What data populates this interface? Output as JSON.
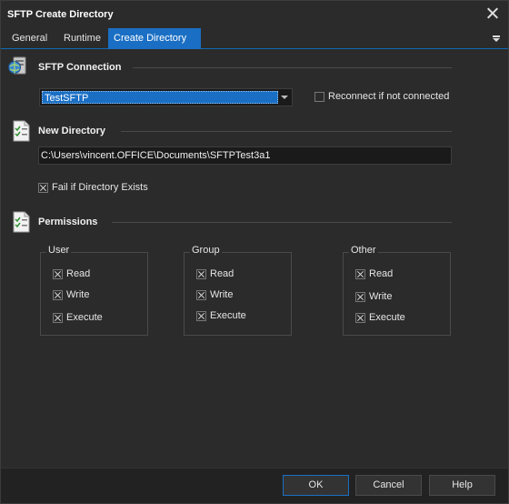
{
  "window": {
    "title": "SFTP Create Directory"
  },
  "tabs": [
    {
      "label": "General"
    },
    {
      "label": "Runtime"
    },
    {
      "label": "Create Directory"
    }
  ],
  "active_tab": "Create Directory",
  "sftp_connection": {
    "heading": "SFTP Connection",
    "selected": "TestSFTP",
    "reconnect_label": "Reconnect if not connected",
    "reconnect_checked": false
  },
  "new_directory": {
    "heading": "New Directory",
    "path": "C:\\Users\\vincent.OFFICE\\Documents\\SFTPTest3a1",
    "fail_label": "Fail if Directory Exists",
    "fail_checked": true
  },
  "permissions": {
    "heading": "Permissions",
    "groups": [
      {
        "title": "User",
        "read": "Read",
        "write": "Write",
        "execute": "Execute"
      },
      {
        "title": "Group",
        "read": "Read",
        "write": "Write",
        "execute": "Execute"
      },
      {
        "title": "Other",
        "read": "Read",
        "write": "Write",
        "execute": "Execute"
      }
    ]
  },
  "buttons": {
    "ok": "OK",
    "cancel": "Cancel",
    "help": "Help"
  },
  "colors": {
    "background": "#2b2b2b",
    "accent": "#1a6fc4",
    "footer": "#222222"
  }
}
